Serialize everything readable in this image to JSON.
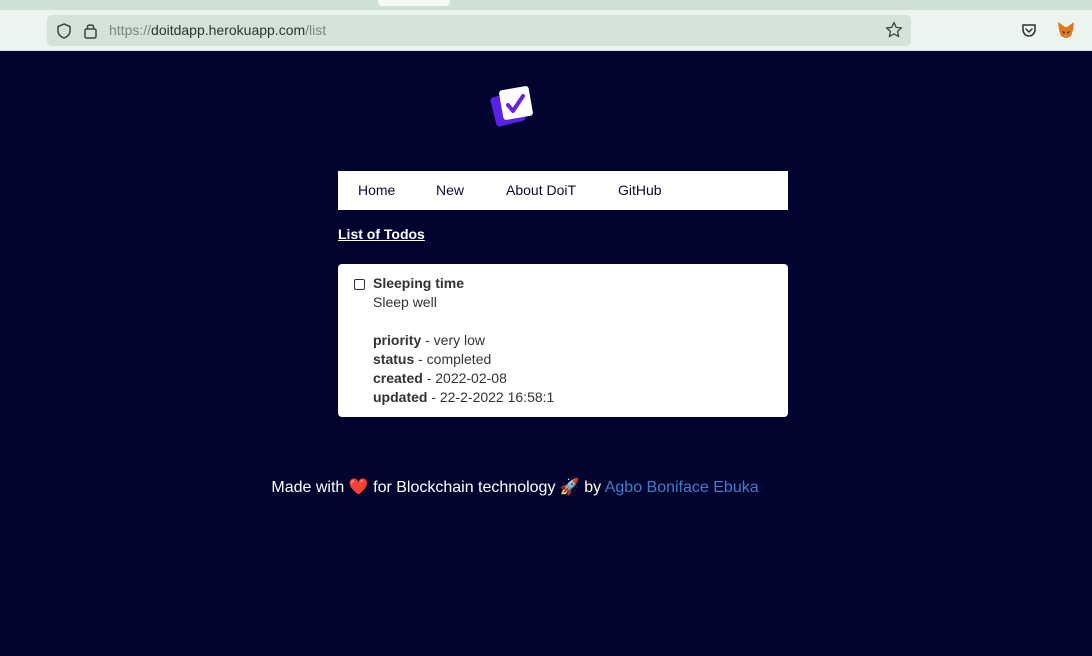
{
  "browser": {
    "url_prefix": "https://",
    "url_host": "doitdapp.herokuapp.com",
    "url_path": "/list"
  },
  "nav": {
    "items": [
      {
        "label": "Home"
      },
      {
        "label": "New"
      },
      {
        "label": "About DoiT"
      },
      {
        "label": "GitHub"
      }
    ]
  },
  "page": {
    "heading": "List of Todos"
  },
  "todo": {
    "completed": false,
    "title": "Sleeping time",
    "description": "Sleep well",
    "priority_label": "priority",
    "priority_value": " - very low",
    "status_label": "status",
    "status_value": " - completed",
    "created_label": "created",
    "created_value": " - 2022-02-08",
    "updated_label": "updated",
    "updated_value": " - 22-2-2022 16:58:1"
  },
  "footer": {
    "made_with": "Made with ",
    "heart": "❤️",
    "for_text": " for Blockchain technology ",
    "rocket": "🚀",
    "by_text": " by ",
    "author": "Agbo Boniface Ebuka"
  },
  "colors": {
    "page_bg": "#020430",
    "link": "#3f7fc8",
    "logo_front": "#ffffff",
    "logo_back": "#5a22e6",
    "check": "#6a1fe0"
  }
}
